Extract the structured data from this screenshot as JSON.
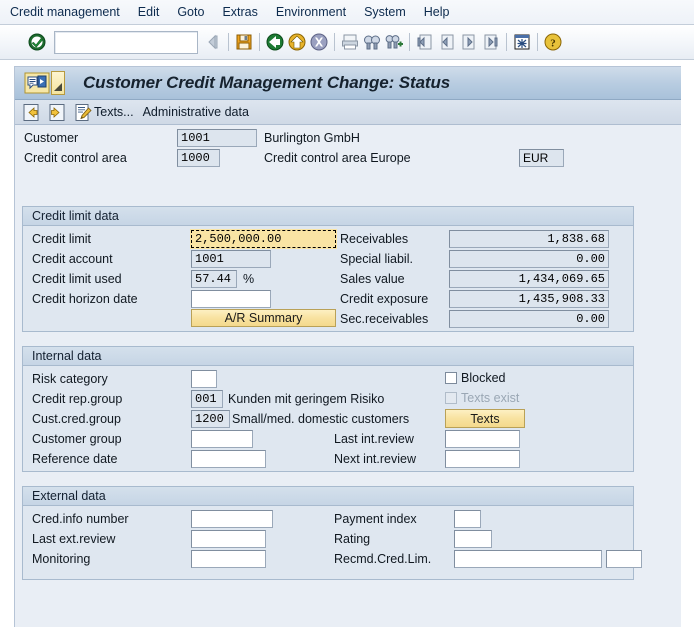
{
  "menu": {
    "items": [
      {
        "label": "Credit management"
      },
      {
        "label": "Edit"
      },
      {
        "label": "Goto"
      },
      {
        "label": "Extras"
      },
      {
        "label": "Environment"
      },
      {
        "label": "System"
      },
      {
        "label": "Help"
      }
    ]
  },
  "toolbar": {
    "command_value": "",
    "command_placeholder": "",
    "icons": [
      {
        "name": "enter-check-icon"
      },
      {
        "name": "back-arrow-icon"
      },
      {
        "name": "save-icon"
      },
      {
        "name": "back-green-icon"
      },
      {
        "name": "exit-yellow-icon"
      },
      {
        "name": "cancel-icon"
      },
      {
        "name": "print-icon"
      },
      {
        "name": "find-icon"
      },
      {
        "name": "find-next-icon"
      },
      {
        "name": "first-page-icon"
      },
      {
        "name": "previous-page-icon"
      },
      {
        "name": "next-page-icon"
      },
      {
        "name": "last-page-icon"
      },
      {
        "name": "create-session-icon"
      },
      {
        "name": "help-icon"
      }
    ]
  },
  "titlebar": {
    "title": "Customer Credit Management Change: Status",
    "icon": "credit-management-icon",
    "dropdown": "menu-dropdown-arrow"
  },
  "appbar": {
    "icons": [
      {
        "name": "previous-customer-icon"
      },
      {
        "name": "next-customer-icon"
      },
      {
        "name": "texts-edit-icon"
      }
    ],
    "texts_label": "Texts...",
    "admin_label": "Administrative data"
  },
  "header": {
    "customer_label": "Customer",
    "customer_value": "1001",
    "customer_name": "Burlington GmbH",
    "cca_label": "Credit control area",
    "cca_value": "1000",
    "cca_name": "Credit control area Europe",
    "currency_value": "EUR"
  },
  "credit_limit_data": {
    "group_title": "Credit limit data",
    "credit_limit_label": "Credit limit",
    "credit_limit_value": "2,500,000.00",
    "credit_account_label": "Credit account",
    "credit_account_value": "1001",
    "credit_limit_used_label": "Credit limit used",
    "credit_limit_used_value": "57.44",
    "percent_sign": "%",
    "credit_horizon_label": "Credit horizon date",
    "credit_horizon_value": "",
    "ar_summary_label": "A/R Summary",
    "receivables_label": "Receivables",
    "receivables_value": "1,838.68",
    "special_liabil_label": "Special liabil.",
    "special_liabil_value": "0.00",
    "sales_value_label": "Sales value",
    "sales_value_value": "1,434,069.65",
    "credit_exposure_label": "Credit exposure",
    "credit_exposure_value": "1,435,908.33",
    "sec_receivables_label": "Sec.receivables",
    "sec_receivables_value": "0.00"
  },
  "internal_data": {
    "group_title": "Internal data",
    "risk_category_label": "Risk category",
    "risk_category_value": "",
    "credit_rep_group_label": "Credit rep.group",
    "credit_rep_group_value": "001",
    "credit_rep_group_text": "Kunden mit geringem Risiko",
    "cust_cred_group_label": "Cust.cred.group",
    "cust_cred_group_value": "1200",
    "cust_cred_group_text": "Small/med. domestic customers",
    "customer_group_label": "Customer group",
    "customer_group_value": "",
    "reference_date_label": "Reference date",
    "reference_date_value": "",
    "blocked_label": "Blocked",
    "blocked_checked": false,
    "texts_exist_label": "Texts exist",
    "texts_exist_checked": false,
    "texts_button_label": "Texts",
    "last_int_review_label": "Last int.review",
    "last_int_review_value": "",
    "next_int_review_label": "Next int.review",
    "next_int_review_value": ""
  },
  "external_data": {
    "group_title": "External data",
    "cred_info_number_label": "Cred.info number",
    "cred_info_number_value": "",
    "last_ext_review_label": "Last ext.review",
    "last_ext_review_value": "",
    "monitoring_label": "Monitoring",
    "monitoring_value": "",
    "payment_index_label": "Payment index",
    "payment_index_value": "",
    "rating_label": "Rating",
    "rating_value": "",
    "recmd_cred_lim_label": "Recmd.Cred.Lim.",
    "recmd_cred_lim_value": "",
    "recmd_cred_lim_currency": ""
  },
  "colors": {
    "accent_yellow": "#f8e2a0",
    "panel_bg": "#dfe7f0",
    "screen_bg": "#e9eef5",
    "titlebar": "#b9cde1",
    "field_gray": "#dde5ee",
    "border": "#a8bace"
  }
}
